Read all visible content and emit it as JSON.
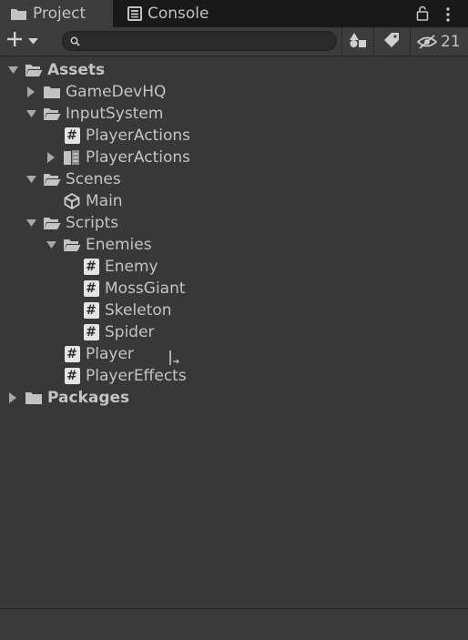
{
  "tabs": [
    {
      "label": "Project",
      "icon": "folder-icon",
      "active": true
    },
    {
      "label": "Console",
      "icon": "console-icon",
      "active": false
    }
  ],
  "toolbar": {
    "search_value": "",
    "hidden_count": "21"
  },
  "tree": [
    {
      "label": "Assets",
      "icon": "folder-open-icon",
      "depth": 0,
      "expanded": true,
      "bold": true
    },
    {
      "label": "GameDevHQ",
      "icon": "folder-icon",
      "depth": 1,
      "expanded": false
    },
    {
      "label": "InputSystem",
      "icon": "folder-open-icon",
      "depth": 1,
      "expanded": true
    },
    {
      "label": "PlayerActions",
      "icon": "csharp-script-icon",
      "depth": 2,
      "leaf": true
    },
    {
      "label": "PlayerActions",
      "icon": "input-actions-icon",
      "depth": 2,
      "expanded": false
    },
    {
      "label": "Scenes",
      "icon": "folder-open-icon",
      "depth": 1,
      "expanded": true
    },
    {
      "label": "Main",
      "icon": "unity-scene-icon",
      "depth": 2,
      "leaf": true
    },
    {
      "label": "Scripts",
      "icon": "folder-open-icon",
      "depth": 1,
      "expanded": true
    },
    {
      "label": "Enemies",
      "icon": "folder-open-icon",
      "depth": 2,
      "expanded": true
    },
    {
      "label": "Enemy",
      "icon": "csharp-script-icon",
      "depth": 3,
      "leaf": true
    },
    {
      "label": "MossGiant",
      "icon": "csharp-script-icon",
      "depth": 3,
      "leaf": true
    },
    {
      "label": "Skeleton",
      "icon": "csharp-script-icon",
      "depth": 3,
      "leaf": true
    },
    {
      "label": "Spider",
      "icon": "csharp-script-icon",
      "depth": 3,
      "leaf": true
    },
    {
      "label": "Player",
      "icon": "csharp-script-icon",
      "depth": 2,
      "leaf": true
    },
    {
      "label": "PlayerEffects",
      "icon": "csharp-script-icon",
      "depth": 2,
      "leaf": true
    },
    {
      "label": "Packages",
      "icon": "folder-icon",
      "depth": 0,
      "expanded": false,
      "bold": true
    }
  ],
  "colors": {
    "background": "#383838",
    "tabbar": "#191919",
    "text": "#c4c4c4",
    "script_icon": "#e4e4e4"
  }
}
